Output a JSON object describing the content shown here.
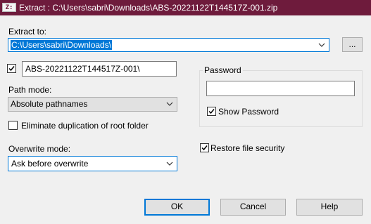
{
  "window": {
    "title": "Extract : C:\\Users\\sabri\\Downloads\\ABS-20221122T144517Z-001.zip",
    "icon_text": "Z:"
  },
  "extract_to": {
    "label": "Extract to:",
    "value": "C:\\Users\\sabri\\Downloads\\",
    "browse_label": "..."
  },
  "subfolder": {
    "checked": true,
    "value": "ABS-20221122T144517Z-001\\"
  },
  "path_mode": {
    "label": "Path mode:",
    "selected": "Absolute pathnames"
  },
  "eliminate_duplication": {
    "checked": false,
    "label": "Eliminate duplication of root folder"
  },
  "password": {
    "group_label": "Password",
    "value": "",
    "show_password": {
      "checked": true,
      "label": "Show Password"
    }
  },
  "overwrite_mode": {
    "label": "Overwrite mode:",
    "selected": "Ask before overwrite"
  },
  "restore_security": {
    "checked": true,
    "label": "Restore file security"
  },
  "buttons": {
    "ok": "OK",
    "cancel": "Cancel",
    "help": "Help"
  },
  "colors": {
    "titlebar": "#6e1b3c",
    "accent": "#0078d7",
    "background": "#f0f0f0"
  }
}
